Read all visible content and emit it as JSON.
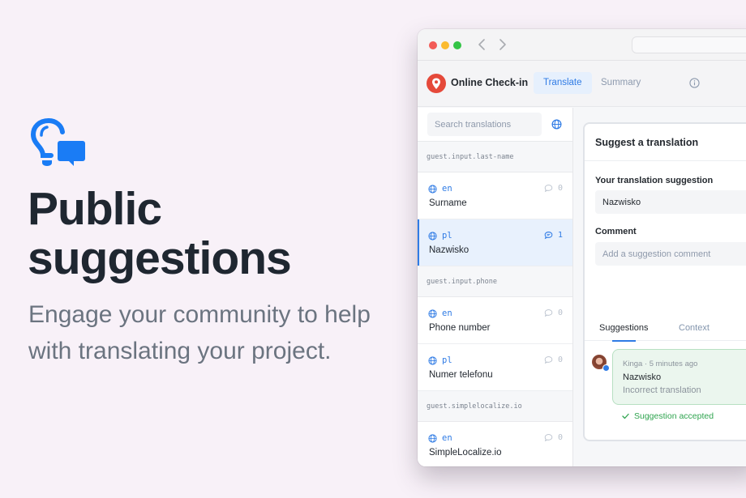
{
  "hero": {
    "icon": "lightbulb-chat-icon",
    "title_line1": "Public",
    "title_line2": "suggestions",
    "subtitle": "Engage your community to help with translating your project.",
    "accent_color": "#1a7cf5"
  },
  "window": {
    "traffic_lights": [
      "close",
      "minimize",
      "zoom"
    ],
    "nav_back": "‹",
    "nav_forward": "›"
  },
  "app": {
    "title": "Online Check-in",
    "logo_icon": "map-pin-icon",
    "logo_color": "#e5493a",
    "tabs": [
      {
        "label": "Translate",
        "active": true
      },
      {
        "label": "Summary",
        "active": false
      }
    ],
    "info_icon": "info-icon",
    "accent_color": "#2f7be5"
  },
  "sidebar": {
    "search_placeholder": "Search translations",
    "groups": [
      {
        "key": "guest.input.last-name",
        "rows": [
          {
            "lang": "en",
            "text": "Surname",
            "comments": "0",
            "active": false
          },
          {
            "lang": "pl",
            "text": "Nazwisko",
            "comments": "1",
            "active": true
          }
        ]
      },
      {
        "key": "guest.input.phone",
        "rows": [
          {
            "lang": "en",
            "text": "Phone number",
            "comments": "0",
            "active": false
          },
          {
            "lang": "pl",
            "text": "Numer telefonu",
            "comments": "0",
            "active": false
          }
        ]
      },
      {
        "key": "guest.simplelocalize.io",
        "rows": [
          {
            "lang": "en",
            "text": "SimpleLocalize.io",
            "comments": "0",
            "active": false
          }
        ]
      }
    ]
  },
  "panel": {
    "title": "Suggest a translation",
    "suggestion_label": "Your translation suggestion",
    "suggestion_value": "Nazwisko",
    "comment_label": "Comment",
    "comment_placeholder": "Add a suggestion comment",
    "tabs": [
      {
        "label": "Suggestions",
        "active": true
      },
      {
        "label": "Context",
        "active": false
      }
    ],
    "suggestion": {
      "author": "Kinga",
      "time": "5 minutes ago",
      "meta": "Kinga · 5 minutes ago",
      "text": "Nazwisko",
      "comment": "Incorrect translation",
      "status": "Suggestion accepted",
      "status_color": "#2fa44f"
    }
  }
}
